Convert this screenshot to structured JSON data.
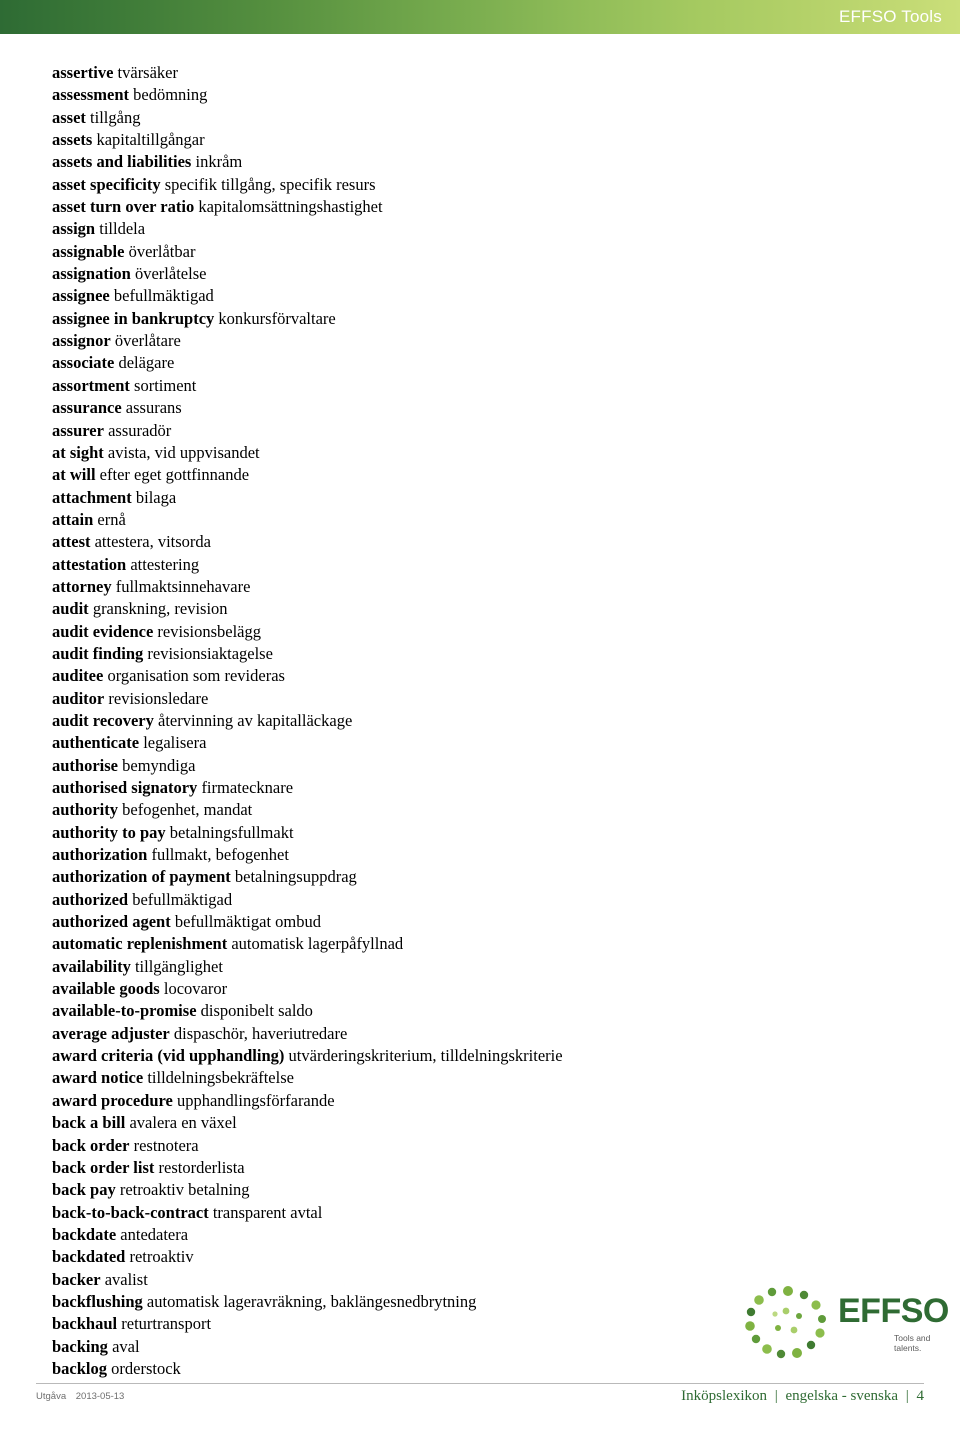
{
  "header": {
    "title": "EFFSO Tools",
    "gradient_from": "#2e6b34",
    "gradient_to": "#cbdf7a"
  },
  "glossary": {
    "entries": [
      {
        "term": "assertive",
        "definition": "tvärsäker"
      },
      {
        "term": "assessment",
        "definition": "bedömning"
      },
      {
        "term": "asset",
        "definition": "tillgång"
      },
      {
        "term": "assets",
        "definition": "kapitaltillgångar"
      },
      {
        "term": "assets and liabilities",
        "definition": "inkråm"
      },
      {
        "term": "asset specificity",
        "definition": "specifik tillgång, specifik resurs"
      },
      {
        "term": "asset turn over ratio",
        "definition": "kapitalomsättningshastighet"
      },
      {
        "term": "assign",
        "definition": "tilldela"
      },
      {
        "term": "assignable",
        "definition": "överlåtbar"
      },
      {
        "term": "assignation",
        "definition": "överlåtelse"
      },
      {
        "term": "assignee",
        "definition": "befullmäktigad"
      },
      {
        "term": "assignee in bankruptcy",
        "definition": "konkursförvaltare"
      },
      {
        "term": "assignor",
        "definition": "överlåtare"
      },
      {
        "term": "associate",
        "definition": "delägare"
      },
      {
        "term": "assortment",
        "definition": "sortiment"
      },
      {
        "term": "assurance",
        "definition": "assurans"
      },
      {
        "term": "assurer",
        "definition": "assuradör"
      },
      {
        "term": "at sight",
        "definition": "avista, vid uppvisandet"
      },
      {
        "term": "at will",
        "definition": "efter eget gottfinnande"
      },
      {
        "term": "attachment",
        "definition": "bilaga"
      },
      {
        "term": "attain",
        "definition": "ernå"
      },
      {
        "term": "attest",
        "definition": "attestera, vitsorda"
      },
      {
        "term": "attestation",
        "definition": "attestering"
      },
      {
        "term": "attorney",
        "definition": "fullmaktsinnehavare"
      },
      {
        "term": "audit",
        "definition": "granskning, revision"
      },
      {
        "term": "audit evidence",
        "definition": "revisionsbelägg"
      },
      {
        "term": "audit finding",
        "definition": "revisionsiaktagelse"
      },
      {
        "term": "auditee",
        "definition": "organisation som revideras"
      },
      {
        "term": "auditor",
        "definition": "revisionsledare"
      },
      {
        "term": "audit recovery",
        "definition": "återvinning av kapitalläckage"
      },
      {
        "term": "authenticate",
        "definition": "legalisera"
      },
      {
        "term": "authorise",
        "definition": "bemyndiga"
      },
      {
        "term": "authorised signatory",
        "definition": "firmatecknare"
      },
      {
        "term": "authority",
        "definition": "befogenhet, mandat"
      },
      {
        "term": "authority to pay",
        "definition": "betalningsfullmakt"
      },
      {
        "term": "authorization",
        "definition": "fullmakt, befogenhet"
      },
      {
        "term": "authorization of payment",
        "definition": "betalningsuppdrag"
      },
      {
        "term": "authorized",
        "definition": "befullmäktigad"
      },
      {
        "term": "authorized agent",
        "definition": "befullmäktigat ombud"
      },
      {
        "term": "automatic replenishment",
        "definition": "automatisk lagerpåfyllnad"
      },
      {
        "term": "availability",
        "definition": "tillgänglighet"
      },
      {
        "term": "available goods",
        "definition": "locovaror"
      },
      {
        "term": "available-to-promise",
        "definition": "disponibelt saldo"
      },
      {
        "term": "average adjuster",
        "definition": "dispaschör, haveriutredare"
      },
      {
        "term": "award criteria (vid upphandling)",
        "definition": "utvärderingskriterium, tilldelningskriterie"
      },
      {
        "term": "award notice",
        "definition": "tilldelningsbekräftelse"
      },
      {
        "term": "award procedure",
        "definition": "upphandlingsförfarande"
      },
      {
        "term": "back a bill",
        "definition": "avalera en växel"
      },
      {
        "term": "back order",
        "definition": "restnotera"
      },
      {
        "term": "back order list",
        "definition": "restorderlista"
      },
      {
        "term": "back pay",
        "definition": "retroaktiv betalning"
      },
      {
        "term": "back-to-back-contract",
        "definition": "transparent avtal"
      },
      {
        "term": "backdate",
        "definition": "antedatera"
      },
      {
        "term": "backdated",
        "definition": "retroaktiv"
      },
      {
        "term": "backer",
        "definition": "avalist"
      },
      {
        "term": "backflushing",
        "definition": "automatisk lageravräkning, baklängesnedbrytning"
      },
      {
        "term": "backhaul",
        "definition": "returtransport"
      },
      {
        "term": "backing",
        "definition": "aval"
      },
      {
        "term": "backlog",
        "definition": "orderstock"
      }
    ]
  },
  "logo": {
    "wordmark": "EFFSO",
    "tagline": "Tools and talents.",
    "color": "#2f6b33"
  },
  "footer": {
    "edition_label": "Utgåva",
    "edition_date": "2013-05-13",
    "title": "Inköpslexikon",
    "languages": "engelska - svenska",
    "page_number": "4",
    "separator": "|"
  }
}
